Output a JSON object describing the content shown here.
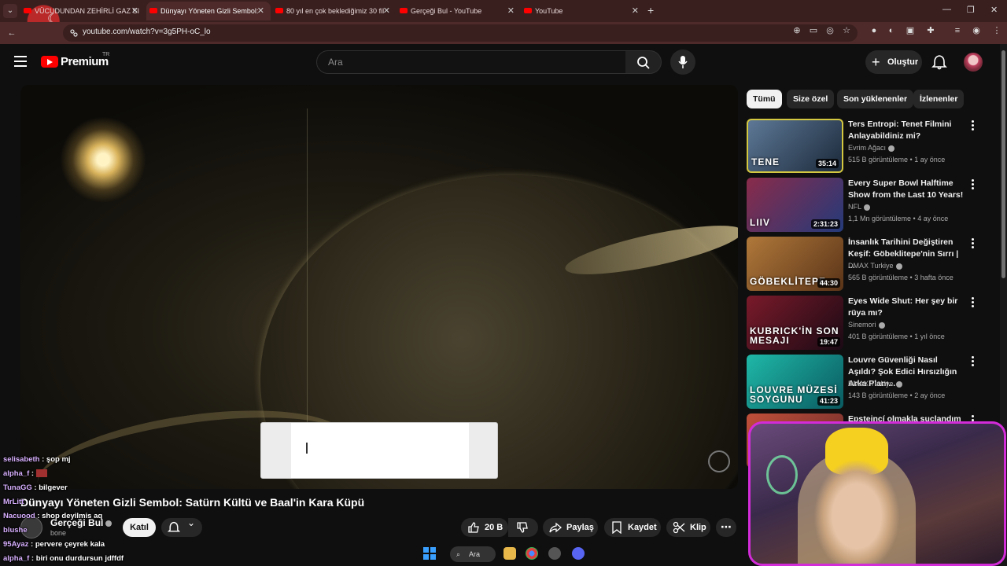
{
  "browser": {
    "tabs": [
      {
        "label": "VÜCUDUNDAN ZEHİRLİ GAZ SI",
        "active": false
      },
      {
        "label": "Dünyayı Yöneten Gizli Sembol:",
        "active": true
      },
      {
        "label": "80 yıl en çok beklediğimiz 30 fil",
        "active": false
      },
      {
        "label": "Gerçeği Bul - YouTube",
        "active": false
      },
      {
        "label": "YouTube",
        "active": false
      }
    ],
    "url": "youtube.com/watch?v=3g5PH-oC_lo"
  },
  "header": {
    "logo_text": "Premium",
    "logo_sup": "TR",
    "search_placeholder": "Ara",
    "create_label": "Oluştur"
  },
  "video": {
    "title": "Dünyayı Yöneten Gizli Sembol: Satürn Kültü ve Baal'in Kara Küpü",
    "channel": "Gerçeği Bul",
    "subscribers": "bone",
    "join_label": "Katıl",
    "likes": "20 B",
    "share_label": "Paylaş",
    "save_label": "Kaydet",
    "clip_label": "Klip"
  },
  "chat": [
    {
      "user": "selisabeth",
      "msg": "şop mj"
    },
    {
      "user": "alpha_f",
      "msg": ""
    },
    {
      "user": "TunaGG",
      "msg": "bilgever"
    },
    {
      "user": "MrLitt",
      "msg": ""
    },
    {
      "user": "Nacuood",
      "msg": "shop deyilmis aq"
    },
    {
      "user": "blushe",
      "msg": ""
    },
    {
      "user": "95Ayaz",
      "msg": "pervere çeyrek kala"
    },
    {
      "user": "alpha_f",
      "msg": "biri onu durdursun jdffdf"
    }
  ],
  "chips": [
    "Tümü",
    "Size özel",
    "Son yüklenenler",
    "İzlenenler"
  ],
  "recommendations": [
    {
      "title": "Ters Entropi: Tenet Filmini Anlayabildiniz mi?",
      "channel": "Evrim Ağacı",
      "meta": "515 B görüntüleme • 1 ay önce",
      "duration": "35:14",
      "thumb_text": "TENE",
      "colors": [
        "#5d7896",
        "#1c2a3b"
      ]
    },
    {
      "title": "Every Super Bowl Halftime Show from the Last 10 Years!",
      "channel": "NFL",
      "meta": "1,1 Mn görüntüleme • 4 ay önce",
      "duration": "2:31:23",
      "thumb_text": "LIIV",
      "colors": [
        "#8a2b4a",
        "#243a7a"
      ]
    },
    {
      "title": "İnsanlık Tarihini Değiştiren Keşif: Göbeklitepe'nin Sırrı | ...",
      "channel": "DMAX Turkiye",
      "meta": "565 B görüntüleme • 3 hafta önce",
      "duration": "44:30",
      "thumb_text": "GÖBEKLİTEPE",
      "colors": [
        "#b0783a",
        "#5a3418"
      ]
    },
    {
      "title": "Eyes Wide Shut: Her şey bir rüya mı?",
      "channel": "Sinemori",
      "meta": "401 B görüntüleme • 1 yıl önce",
      "duration": "19:47",
      "thumb_text": "KUBRICK'İN SON MESAJI",
      "colors": [
        "#7a1a2a",
        "#1a0a14"
      ]
    },
    {
      "title": "Louvre Güvenliği Nasıl Aşıldı? Şok Edici Hırsızlığın Arka Planı...",
      "channel": "DMAX Turkiye",
      "meta": "143 B görüntüleme • 2 ay önce",
      "duration": "41:23",
      "thumb_text": "LOUVRE MÜZESİ SOYGUNU",
      "colors": [
        "#1fb8a8",
        "#0a5a60"
      ]
    },
    {
      "title": "Epsteincí olmakla suçlandım",
      "channel": "",
      "meta": "",
      "duration": "",
      "thumb_text": "",
      "colors": [
        "#c0503a",
        "#6a2a2a"
      ]
    }
  ],
  "taskbar": {
    "search_label": "Ara"
  },
  "accent": "#ff0000"
}
